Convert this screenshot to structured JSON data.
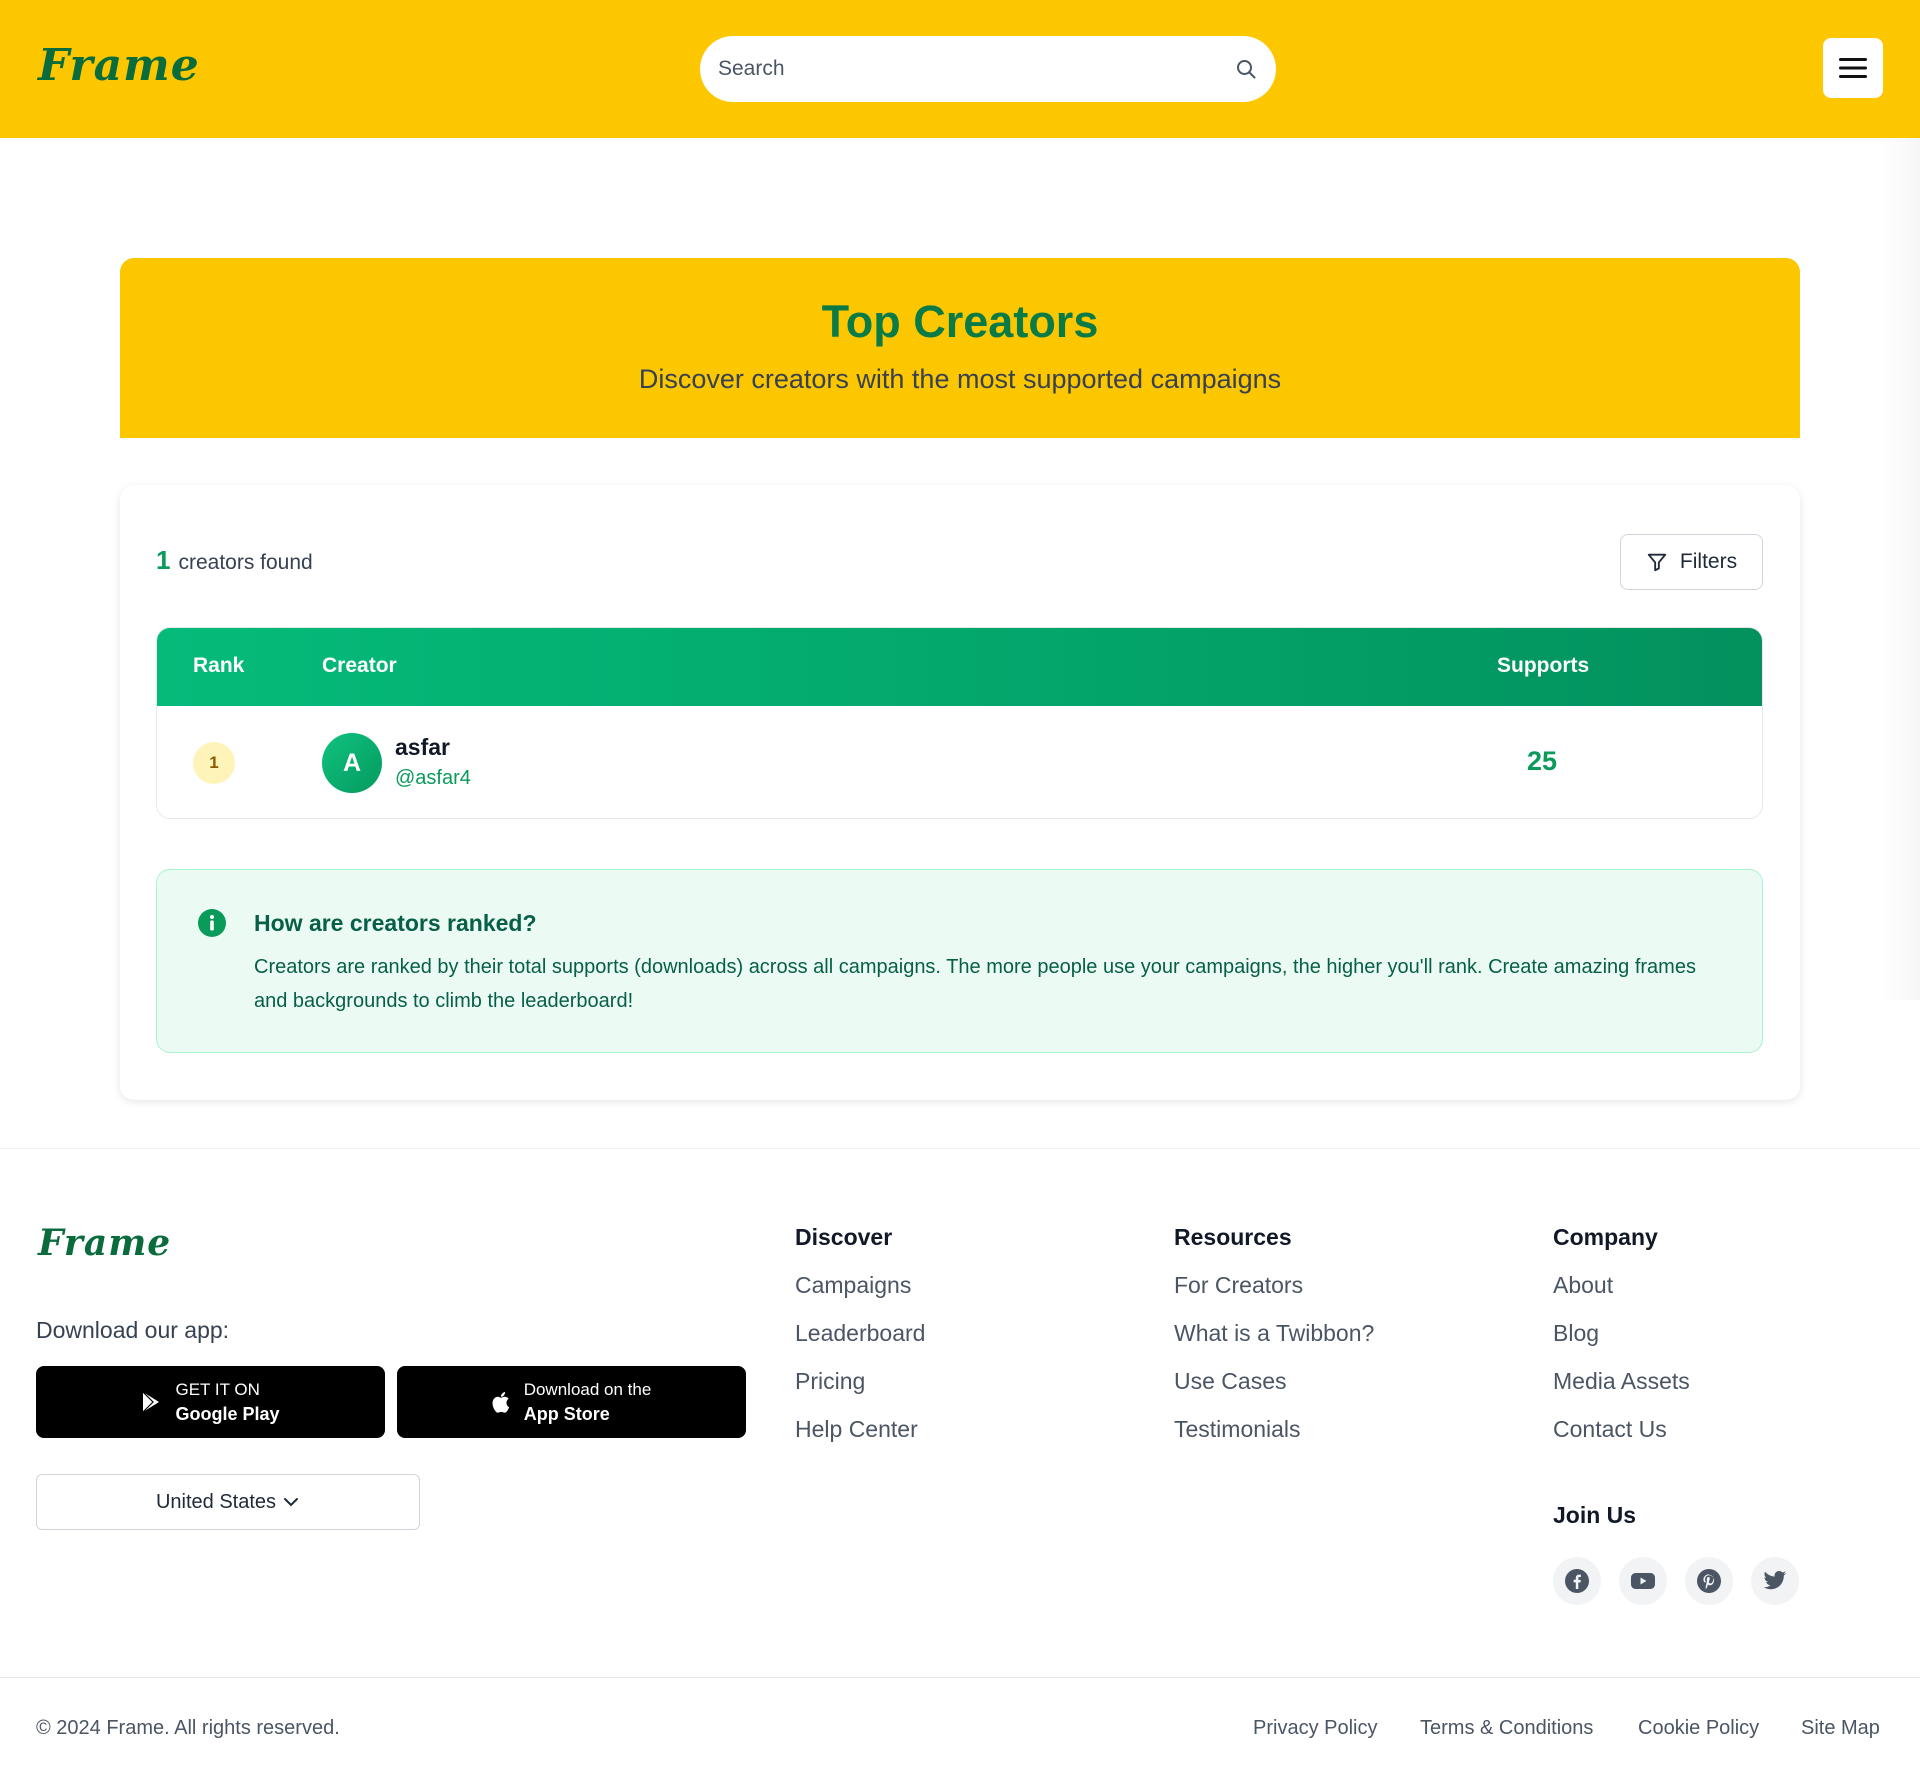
{
  "header": {
    "logo": "Frame",
    "search_placeholder": "Search",
    "colors": {
      "brand_yellow": "#fdc700",
      "brand_green": "#0a7a46"
    }
  },
  "hero": {
    "title": "Top Creators",
    "subtitle": "Discover creators with the most supported campaigns"
  },
  "results": {
    "count": "1",
    "count_label": "creators found",
    "filters_label": "Filters"
  },
  "table": {
    "columns": {
      "rank": "Rank",
      "creator": "Creator",
      "supports": "Supports"
    },
    "rows": [
      {
        "rank": "1",
        "avatar_initial": "A",
        "name": "asfar",
        "handle": "@asfar4",
        "supports": "25"
      }
    ]
  },
  "info": {
    "title": "How are creators ranked?",
    "body": "Creators are ranked by their total supports (downloads) across all campaigns. The more people use your campaigns, the higher you'll rank. Create amazing frames and backgrounds to climb the leaderboard!"
  },
  "footer": {
    "logo": "Frame",
    "download_label": "Download our app:",
    "google_play": {
      "line1": "GET IT ON",
      "line2": "Google Play"
    },
    "app_store": {
      "line1": "Download on the",
      "line2": "App Store"
    },
    "country": "United States",
    "discover": {
      "title": "Discover",
      "links": [
        "Campaigns",
        "Leaderboard",
        "Pricing",
        "Help Center"
      ]
    },
    "resources": {
      "title": "Resources",
      "links": [
        "For Creators",
        "What is a Twibbon?",
        "Use Cases",
        "Testimonials"
      ]
    },
    "company": {
      "title": "Company",
      "links": [
        "About",
        "Blog",
        "Media Assets",
        "Contact Us"
      ]
    },
    "join_us": "Join Us",
    "social_icons": [
      "facebook-icon",
      "youtube-icon",
      "pinterest-icon",
      "twitter-icon"
    ],
    "copyright": "© 2024 Frame. All rights reserved.",
    "legal": [
      "Privacy Policy",
      "Terms & Conditions",
      "Cookie Policy",
      "Site Map"
    ]
  }
}
